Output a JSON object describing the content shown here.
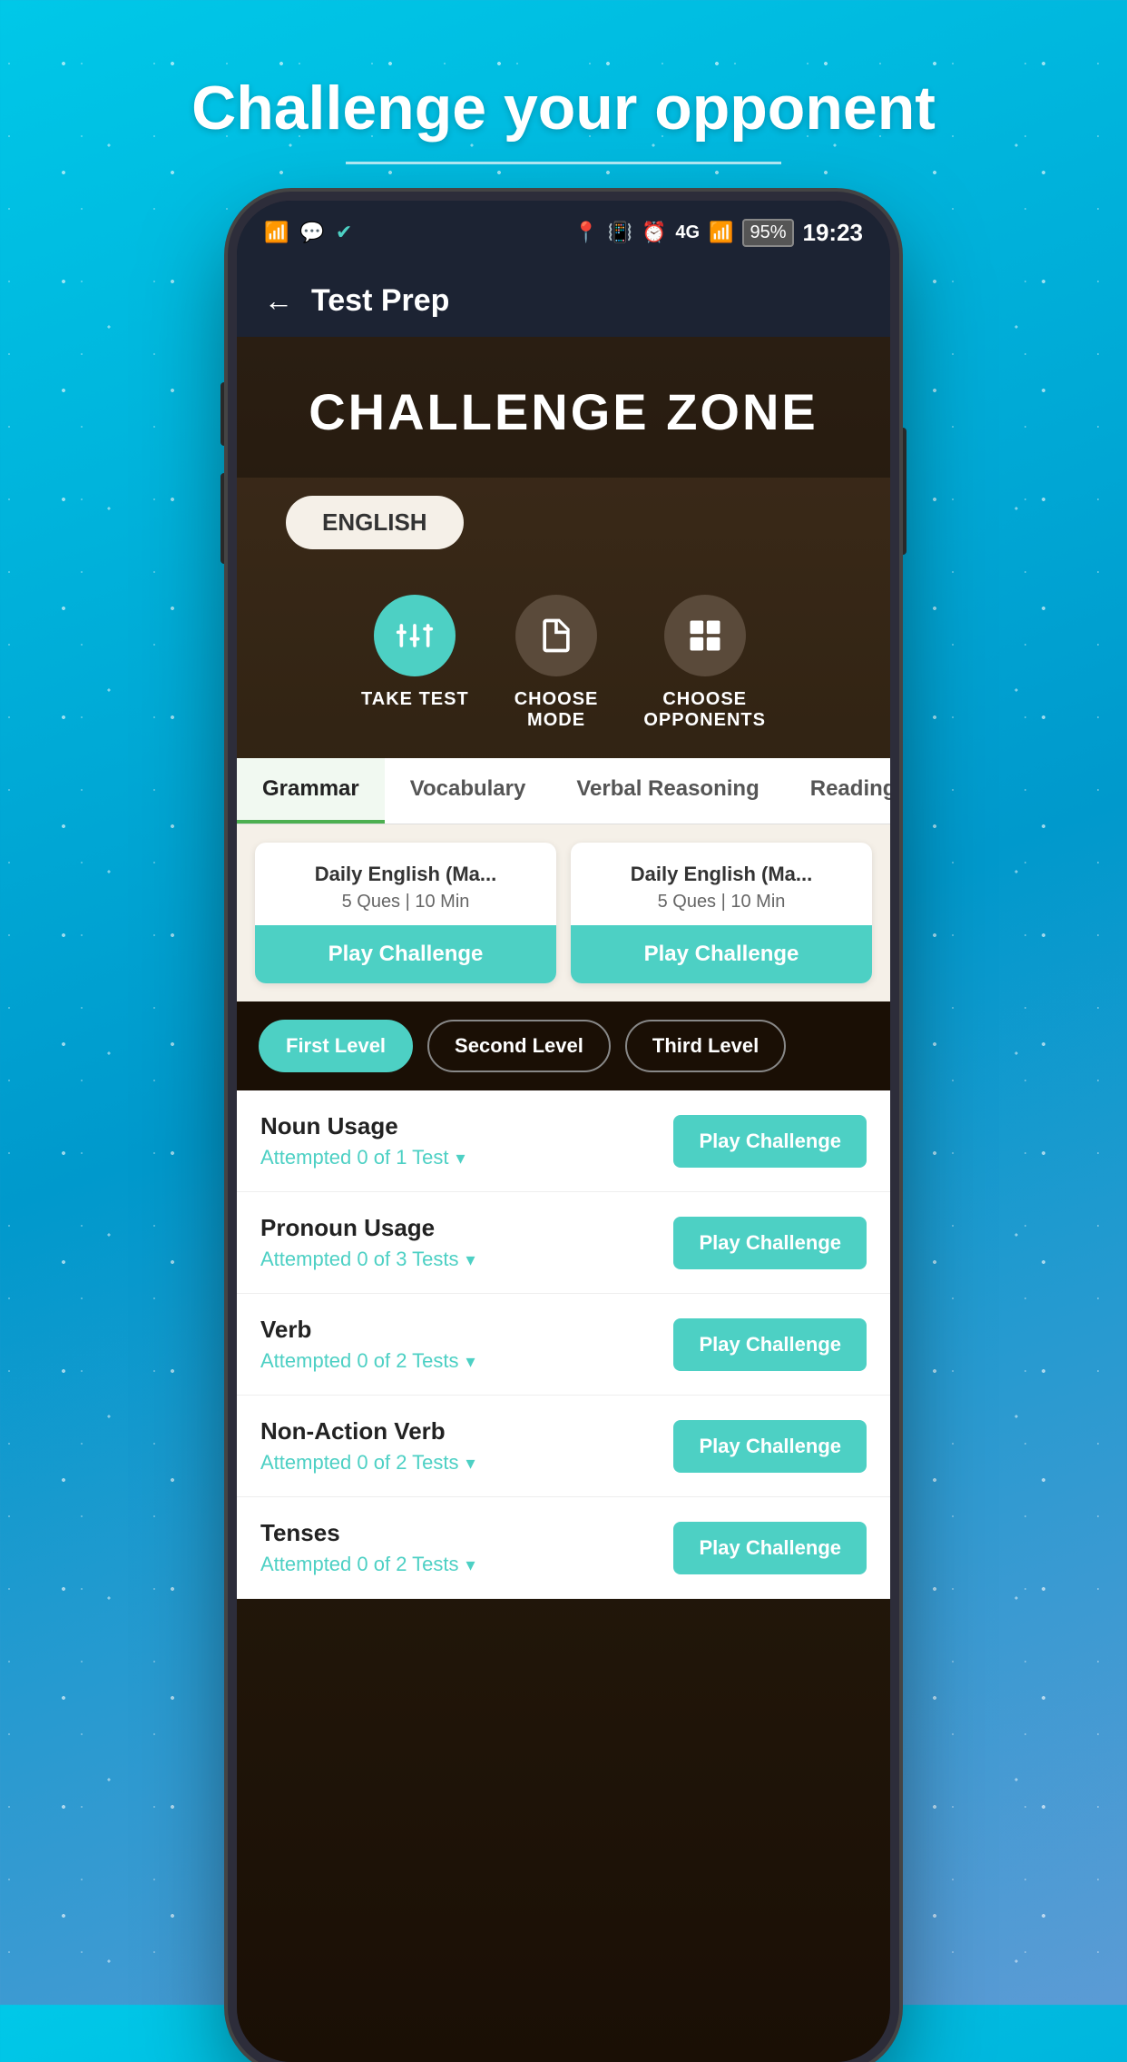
{
  "page": {
    "header_title": "Challenge your opponent",
    "background_color": "#00c8e8"
  },
  "status_bar": {
    "time": "19:23",
    "battery": "95%",
    "signal": "4G"
  },
  "app_bar": {
    "back_label": "←",
    "title": "Test Prep"
  },
  "challenge_zone": {
    "title": "CHALLENGE ZONE",
    "subject": "ENGLISH",
    "actions": [
      {
        "id": "take-test",
        "label": "TAKE TEST",
        "active": true
      },
      {
        "id": "choose-mode",
        "label": "CHOOSE\nMODE",
        "active": false
      },
      {
        "id": "choose-opponents",
        "label": "CHOOSE\nOPPONENTS",
        "active": false
      }
    ],
    "tabs": [
      {
        "id": "grammar",
        "label": "Grammar",
        "active": true
      },
      {
        "id": "vocabulary",
        "label": "Vocabulary",
        "active": false
      },
      {
        "id": "verbal-reasoning",
        "label": "Verbal Reasoning",
        "active": false
      },
      {
        "id": "reading-comprehension",
        "label": "Reading Compreh...",
        "active": false
      }
    ],
    "cards": [
      {
        "title": "Daily English (Ma...",
        "meta": "5 Ques | 10 Min",
        "btn_label": "Play Challenge"
      },
      {
        "title": "Daily English (Ma...",
        "meta": "5 Ques | 10 Min",
        "btn_label": "Play Challenge"
      }
    ],
    "levels": [
      {
        "id": "first-level",
        "label": "First Level",
        "active": true
      },
      {
        "id": "second-level",
        "label": "Second Level",
        "active": false
      },
      {
        "id": "third-level",
        "label": "Third Level",
        "active": false
      }
    ],
    "topics": [
      {
        "name": "Noun Usage",
        "attempts": "Attempted 0 of 1 Test",
        "btn": "Play Challenge"
      },
      {
        "name": "Pronoun Usage",
        "attempts": "Attempted 0 of 3 Tests",
        "btn": "Play Challenge"
      },
      {
        "name": "Verb",
        "attempts": "Attempted 0 of 2 Tests",
        "btn": "Play Challenge"
      },
      {
        "name": "Non-Action Verb",
        "attempts": "Attempted 0 of 2 Tests",
        "btn": "Play Challenge"
      },
      {
        "name": "Tenses",
        "attempts": "Attempted 0 of 2 Tests",
        "btn": "Play Challenge"
      }
    ]
  }
}
